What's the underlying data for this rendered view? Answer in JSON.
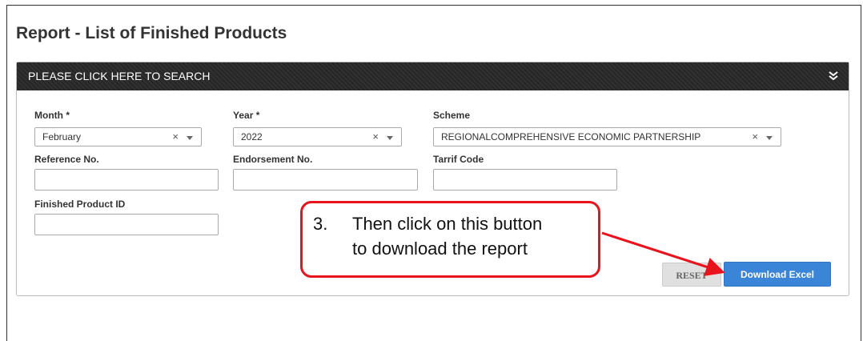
{
  "page": {
    "title": "Report - List of Finished Products"
  },
  "search_panel": {
    "header_label": "PLEASE CLICK HERE TO SEARCH"
  },
  "form": {
    "month": {
      "label": "Month *",
      "value": "February",
      "clear": "×"
    },
    "year": {
      "label": "Year *",
      "value": "2022",
      "clear": "×"
    },
    "scheme": {
      "label": "Scheme",
      "value": "REGIONALCOMPREHENSIVE ECONOMIC PARTNERSHIP",
      "clear": "×"
    },
    "reference_no": {
      "label": "Reference No.",
      "value": ""
    },
    "endorsement_no": {
      "label": "Endorsement No.",
      "value": ""
    },
    "tariff_code": {
      "label": "Tarrif Code",
      "value": ""
    },
    "finished_product_id": {
      "label": "Finished Product ID",
      "value": ""
    }
  },
  "buttons": {
    "reset": "RESET",
    "download": "Download Excel"
  },
  "callout": {
    "number": "3.",
    "line1": "Then click on this button",
    "line2": "to download the report",
    "color": "#e8131c"
  },
  "icons": {
    "collapse": "double-chevron-down-icon"
  }
}
